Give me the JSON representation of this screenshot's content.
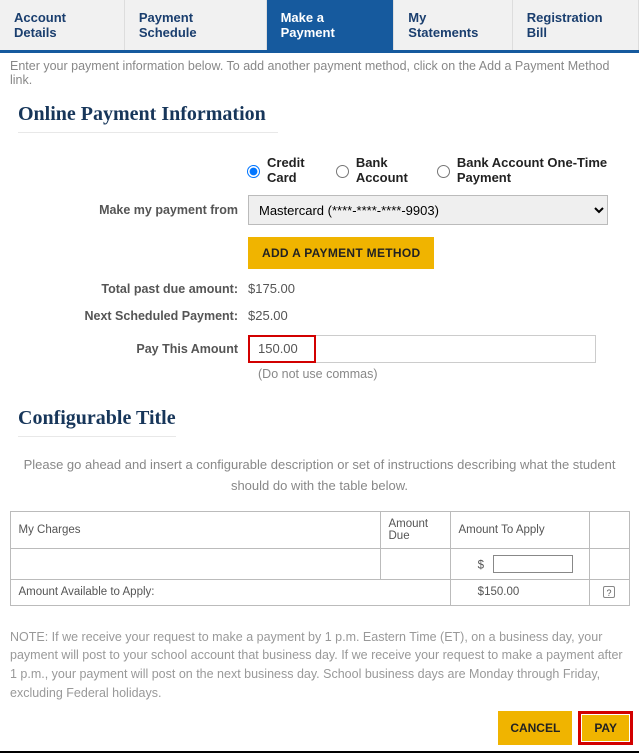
{
  "tabs": {
    "account_details": "Account Details",
    "payment_schedule": "Payment Schedule",
    "make_payment": "Make a Payment",
    "my_statements": "My Statements",
    "registration_bill": "Registration Bill"
  },
  "intro": "Enter your payment information below. To add another payment method, click on the Add a Payment Method link.",
  "section1": {
    "title": "Online Payment Information",
    "radios": {
      "credit_card": "Credit Card",
      "bank_account": "Bank Account",
      "bank_onetime": "Bank Account One-Time Payment"
    },
    "labels": {
      "make_from": "Make my payment from",
      "past_due": "Total past due amount:",
      "next_scheduled": "Next Scheduled Payment:",
      "pay_this": "Pay This Amount"
    },
    "payment_method_option": "Mastercard (****-****-****-9903)",
    "add_method_btn": "ADD A PAYMENT METHOD",
    "past_due_value": "$175.00",
    "next_scheduled_value": "$25.00",
    "pay_this_value": "150.00",
    "hint": "(Do not use commas)"
  },
  "section2": {
    "title": "Configurable Title",
    "desc": "Please go ahead and insert a configurable description or set of instructions describing what the student should do with the table below.",
    "table": {
      "h_charges": "My Charges",
      "h_amount_due": "Amount Due",
      "h_amount_apply": "Amount To Apply",
      "currency": "$",
      "available_label": "Amount Available to Apply:",
      "available_value": "$150.00",
      "help": "?"
    }
  },
  "note": "NOTE: If we receive your request to make a payment by 1 p.m. Eastern Time (ET), on a business day, your payment will post to your school account that business day. If we receive your request to make a payment after 1 p.m., your payment will post on the next business day. School business days are Monday through Friday, excluding Federal holidays.",
  "footer": {
    "cancel": "CANCEL",
    "pay": "PAY"
  }
}
